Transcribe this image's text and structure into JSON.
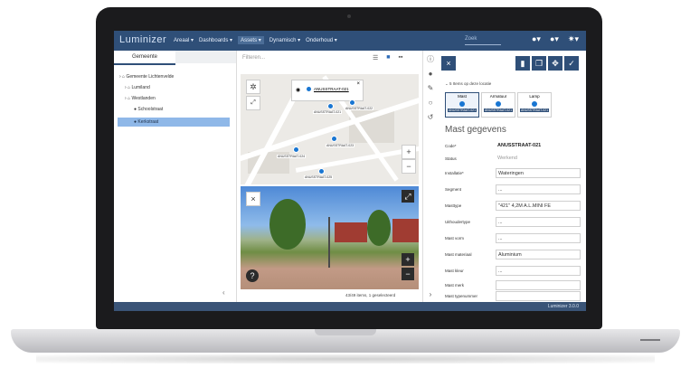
{
  "app": {
    "logo": "Luminizer",
    "nav": [
      "Areaal ▾",
      "Dashboards ▾",
      "Assets ▾",
      "Dynamisch ▾",
      "Onderhoud ▾"
    ],
    "nav_active_index": 2,
    "search_placeholder": "Zoek",
    "top_icons": [
      "account-icon",
      "help-icon",
      "gear-icon"
    ]
  },
  "tree": {
    "tab": "Gemeente",
    "items": [
      {
        "label": "› ⌂ Gemeente Lichtenvelde",
        "selected": false
      },
      {
        "label": "› ⌂ Lumiland",
        "selected": false
      },
      {
        "label": "› ⌂ Westlanden",
        "selected": false
      },
      {
        "label": "● Schoolstraat",
        "selected": false
      },
      {
        "label": "● Kerkstraat",
        "selected": true
      }
    ]
  },
  "map": {
    "filter_placeholder": "Filteren...",
    "popup_label": "ANUSSTRAAT-021",
    "pin_labels": [
      "ANUSSTRAAT-021",
      "ANUSSTRAAT-022",
      "ANUSSTRAAT-023",
      "ANUSSTRAAT-024",
      "ANUSSTRAAT-025"
    ],
    "status": "43/49 items, 1 geselecteerd"
  },
  "detail": {
    "items_text": "5 Items op deze locatie",
    "type_cards": [
      {
        "label": "Mast",
        "value": "ANUSSTRAAT-021",
        "selected": true
      },
      {
        "label": "Armatuur",
        "value": "ANUSSTRAAT-021",
        "selected": false
      },
      {
        "label": "Lamp",
        "value": "ANUSSTRAAT-021",
        "selected": false
      }
    ],
    "title": "Mast gegevens",
    "fields": [
      {
        "label": "Code*",
        "value": "ANUSSTRAAT-021",
        "style": "bold"
      },
      {
        "label": "Status",
        "value": "Werkend",
        "style": "muted"
      },
      {
        "label": "Installatie*",
        "value": "Wateringen",
        "style": "box"
      },
      {
        "label": "Segment",
        "value": "...",
        "style": "box"
      },
      {
        "label": "Masttype",
        "value": "\"421\" 4,2M A.L.MINI FE",
        "style": "box"
      },
      {
        "label": "Uithoudertype",
        "value": "...",
        "style": "box"
      },
      {
        "label": "Mast vorm",
        "value": "...",
        "style": "box"
      },
      {
        "label": "Mast materiaal",
        "value": "Aluminium",
        "style": "box"
      },
      {
        "label": "Mast kleur",
        "value": "...",
        "style": "box"
      },
      {
        "label": "Mast merk",
        "value": "",
        "style": "box"
      },
      {
        "label": "Mast typenummer",
        "value": "",
        "style": "box"
      }
    ]
  },
  "footer": {
    "version": "Luminizer 3.0.0"
  },
  "colors": {
    "header": "#2f4f78",
    "selected": "#8fb8e8",
    "pin": "#1976d2"
  }
}
